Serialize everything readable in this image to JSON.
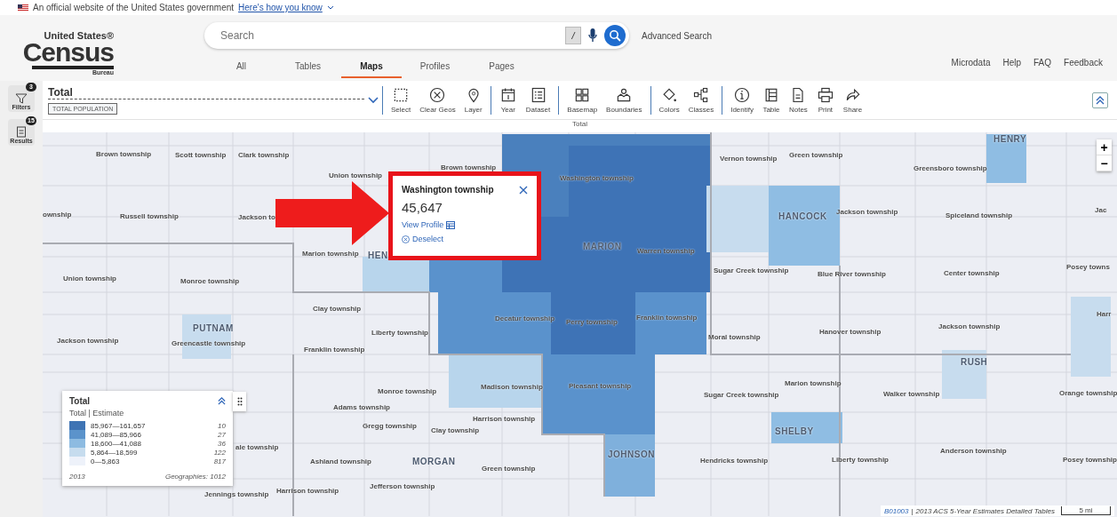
{
  "gov_banner": {
    "text": "An official website of the United States government",
    "link": "Here's how you know"
  },
  "logo": {
    "top": "United States®",
    "main": "Census",
    "bottom": "Bureau"
  },
  "search": {
    "placeholder": "Search",
    "shortcut": "/",
    "advanced": "Advanced Search"
  },
  "nav_tabs": [
    {
      "label": "All",
      "selected": false
    },
    {
      "label": "Tables",
      "selected": false
    },
    {
      "label": "Maps",
      "selected": true
    },
    {
      "label": "Profiles",
      "selected": false
    },
    {
      "label": "Pages",
      "selected": false
    }
  ],
  "utility_links": [
    "Microdata",
    "Help",
    "FAQ",
    "Feedback"
  ],
  "rail": [
    {
      "label": "Filters",
      "badge": "3"
    },
    {
      "label": "Results",
      "badge": "15"
    }
  ],
  "table_selector": {
    "title": "Total",
    "tag": "TOTAL POPULATION"
  },
  "tool_groups": [
    [
      "Select",
      "Clear Geos",
      "Layer"
    ],
    [
      "Year",
      "Dataset"
    ],
    [
      "Basemap",
      "Boundaries"
    ],
    [
      "Colors",
      "Classes"
    ],
    [
      "Identify",
      "Table",
      "Notes",
      "Print",
      "Share"
    ]
  ],
  "map_title": "Total",
  "map_labels": [
    "Brown township",
    "Scott township",
    "Clark township",
    "Union township",
    "Brown township",
    "Washington township",
    "Vernon township",
    "Green township",
    "HENRY",
    "Greensboro township",
    "ownship",
    "Russell township",
    "Jackson to",
    "HANCOCK",
    "Jackson township",
    "Spiceland township",
    "Jac",
    "MARION",
    "Warren township",
    "Marion township",
    "HEN",
    "Sugar Creek township",
    "Blue River township",
    "Center township",
    "Posey towns",
    "Union township",
    "Monroe township",
    "Clay township",
    "PUTNAM",
    "Greencastle township",
    "Liberty township",
    "Decatur township",
    "Perry township",
    "Franklin township",
    "Moral township",
    "Hanover township",
    "Jackson township",
    "Harr",
    "Jackson township",
    "Franklin township",
    "RUSH",
    "Monroe township",
    "Madison township",
    "Pleasant township",
    "Sugar Creek township",
    "Marion township",
    "Walker township",
    "Orange township",
    "Adams township",
    "Harrison township",
    "Gregg township",
    "Clay township",
    "SHELBY",
    "ale township",
    "MORGAN",
    "JOHNSON",
    "Anderson township",
    "Ashland township",
    "Green township",
    "Hendricks township",
    "Liberty township",
    "Posey township",
    "Jefferson township",
    "Harrison township",
    "Jennings township"
  ],
  "popup": {
    "title": "Washington township",
    "value": "45,647",
    "profile_link": "View Profile",
    "deselect": "Deselect"
  },
  "legend": {
    "title": "Total",
    "subtitle": "Total | Estimate",
    "classes": [
      {
        "range": "85,967—161,657",
        "count": "10",
        "color": "#3f74b4"
      },
      {
        "range": "41,089—85,966",
        "count": "27",
        "color": "#5b93cb"
      },
      {
        "range": "18,600—41,088",
        "count": "36",
        "color": "#8dbbe1"
      },
      {
        "range": "5,864—18,599",
        "count": "122",
        "color": "#c6dcee"
      },
      {
        "range": "0—5,863",
        "count": "817",
        "color": "#eef2fa"
      }
    ],
    "year": "2013",
    "geographies": "Geographies: 1012"
  },
  "attribution": {
    "table_id": "B01003",
    "separator": "|",
    "source": "2013 ACS 5-Year Estimates Detailed Tables",
    "scale": "5 mi"
  },
  "zoom_buttons": [
    "+",
    "−"
  ]
}
